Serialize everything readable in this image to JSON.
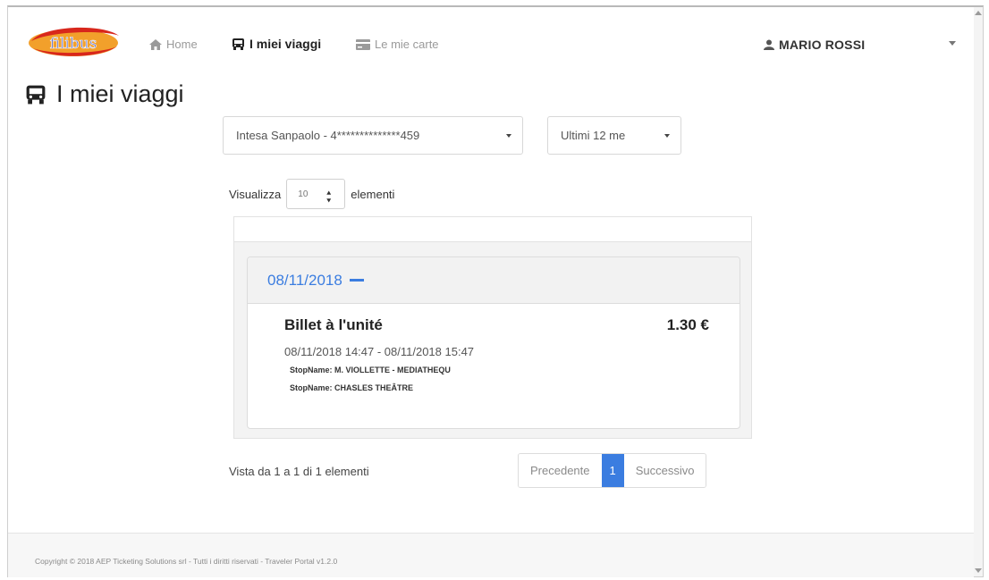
{
  "brand": {
    "logo_text": "filibus",
    "colors": {
      "red": "#d8271c",
      "orange": "#f2a02b",
      "blue": "#5a6fd6"
    }
  },
  "nav": {
    "home": {
      "icon": "home-icon",
      "label": "Home"
    },
    "trips": {
      "icon": "bus-icon",
      "label": "I miei viaggi"
    },
    "cards": {
      "icon": "card-icon",
      "label": "Le mie carte"
    }
  },
  "user": {
    "icon": "user-icon",
    "name": "MARIO ROSSI"
  },
  "page": {
    "title": "I miei viaggi",
    "title_icon": "bus-icon"
  },
  "filters": {
    "card_select": "Intesa Sanpaolo - 4**************459",
    "period_select": "Ultimi 12 me"
  },
  "length": {
    "prefix": "Visualizza",
    "value": "10",
    "suffix": "elementi"
  },
  "days": [
    {
      "date": "08/11/2018",
      "trips": [
        {
          "name": "Billet à l'unité",
          "price": "1.30 €",
          "time": "08/11/2018 14:47 - 08/11/2018 15:47",
          "stops": [
            "StopName: M. VIOLLETTE - MEDIATHEQU",
            "StopName: CHASLES THEÂTRE"
          ]
        }
      ]
    }
  ],
  "info": "Vista da 1 a 1 di 1 elementi",
  "pagination": {
    "prev": "Precedente",
    "current": "1",
    "next": "Successivo"
  },
  "footer": "Copyright © 2018 AEP Ticketing Solutions srl - Tutti i diritti riservati - Traveler Portal v1.2.0",
  "accent": "#3b7de0"
}
